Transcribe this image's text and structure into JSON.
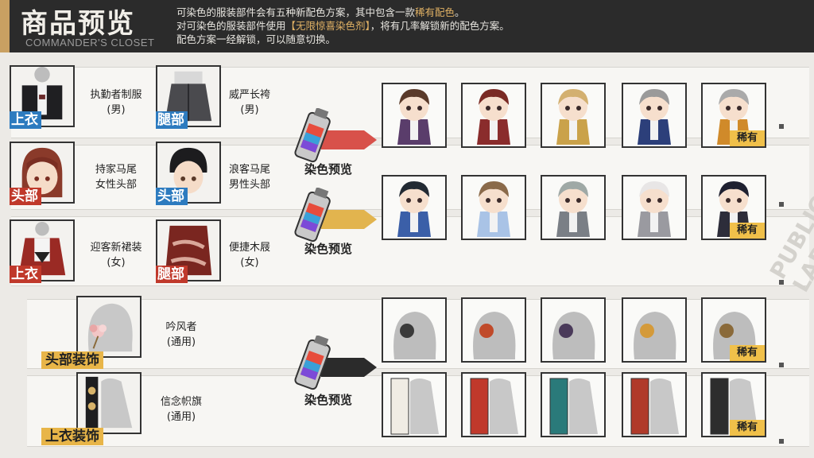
{
  "header": {
    "title": "商品预览",
    "subtitle": "COMMANDER'S CLOSET",
    "notes": [
      {
        "pre": "可染色的服装部件会有五种新配色方案，其中包含一款",
        "highlight": "稀有配色",
        "post": "。"
      },
      {
        "pre": "对可染色的服装部件使用",
        "highlight": "【无限惊喜染色剂】",
        "post": "，将有几率解锁新的配色方案。"
      },
      {
        "pre": "配色方案一经解锁，可以随意切换。",
        "highlight": "",
        "post": ""
      }
    ],
    "accent_color": "#c9a062"
  },
  "rows": [
    {
      "left": {
        "name": "执勤者制服",
        "sub": "(男)",
        "tag": "上衣",
        "tag_color": "blue",
        "icon": "uniform-icon"
      },
      "right": {
        "name": "威严长袴",
        "sub": "(男)",
        "tag": "腿部",
        "tag_color": "blue",
        "icon": "hakama-icon"
      }
    },
    {
      "left": {
        "name": "持家马尾",
        "sub": "女性头部",
        "tag": "头部",
        "tag_color": "red",
        "icon": "female-head-icon"
      },
      "right": {
        "name": "浪客马尾",
        "sub": "男性头部",
        "tag": "头部",
        "tag_color": "blue",
        "icon": "male-head-icon"
      }
    },
    {
      "left": {
        "name": "迎客新裙装",
        "sub": "(女)",
        "tag": "上衣",
        "tag_color": "red",
        "icon": "dress-icon"
      },
      "right": {
        "name": "便捷木屐",
        "sub": "(女)",
        "tag": "腿部",
        "tag_color": "red",
        "icon": "geta-icon"
      }
    }
  ],
  "accessories": [
    {
      "name": "吟风者",
      "sub": "(通用)",
      "tag": "头部装饰",
      "icon": "hair-ornament-icon"
    },
    {
      "name": "信念帜旗",
      "sub": "(通用)",
      "tag": "上衣装饰",
      "icon": "banner-icon"
    }
  ],
  "dye": {
    "label": "染色预览",
    "icon": "dye-spray-icon"
  },
  "rare_label": "稀有",
  "palettes": {
    "male": [
      "#5a3d6b",
      "#8a2c2c",
      "#caa24a",
      "#2c3f7a",
      "#d08a2a"
    ],
    "female": [
      "#3b5fa8",
      "#a9c3e6",
      "#7a7f86",
      "#9a9aa0",
      "#2d2d3a"
    ],
    "hair_male": [
      "#5a3a2a",
      "#7a2a24",
      "#d3b070",
      "#9a9a9a",
      "#aaaaaa"
    ],
    "hair_female": [
      "#222a33",
      "#8a6a4a",
      "#9fa9a6",
      "#e8e6e6",
      "#1e2030"
    ]
  },
  "watermark": "PUBLIC LAB"
}
